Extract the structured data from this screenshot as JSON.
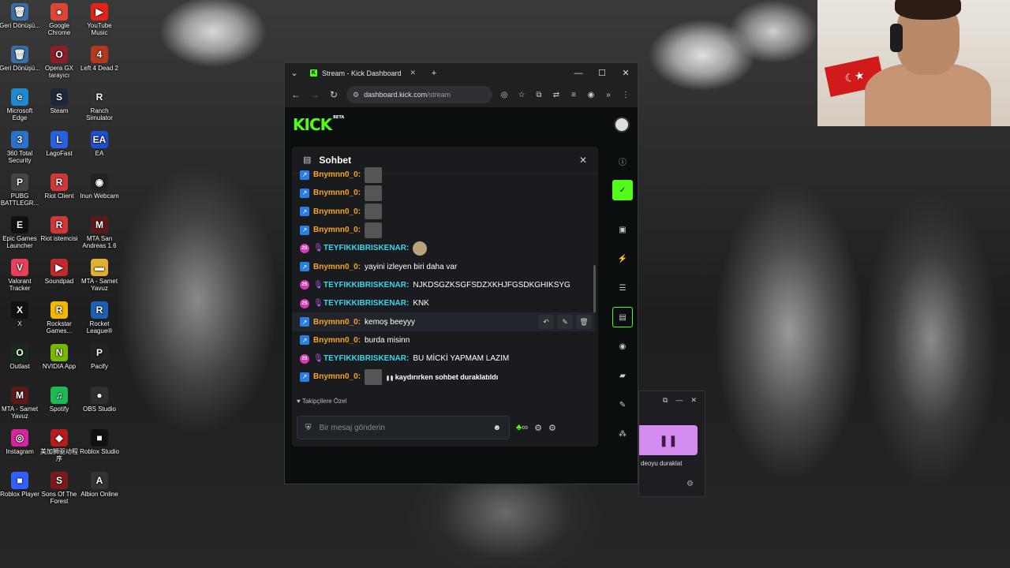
{
  "desktop": {
    "icons": [
      {
        "label": "Geri Dönüşü...",
        "glyph": "🗑",
        "color": "#3b6ea5"
      },
      {
        "label": "Google Chrome",
        "glyph": "●",
        "color": "#db4437"
      },
      {
        "label": "YouTube Music",
        "glyph": "▶",
        "color": "#e62117"
      },
      {
        "label": "Geri Dönüşü...",
        "glyph": "🗑",
        "color": "#3b6ea5"
      },
      {
        "label": "Opera GX tarayıcı",
        "glyph": "O",
        "color": "#8a1f2a"
      },
      {
        "label": "Left 4 Dead 2",
        "glyph": "4",
        "color": "#b03a1a"
      },
      {
        "label": "Microsoft Edge",
        "glyph": "e",
        "color": "#1f8ad0"
      },
      {
        "label": "Steam",
        "glyph": "S",
        "color": "#1b2838"
      },
      {
        "label": "Ranch Simulator",
        "glyph": "R",
        "color": "#333"
      },
      {
        "label": "360 Total Security",
        "glyph": "3",
        "color": "#2a72c9"
      },
      {
        "label": "LagoFast",
        "glyph": "L",
        "color": "#2a5fe0"
      },
      {
        "label": "EA",
        "glyph": "EA",
        "color": "#1f4fd1"
      },
      {
        "label": "PUBG BATTLEGR...",
        "glyph": "P",
        "color": "#444"
      },
      {
        "label": "Riot Client",
        "glyph": "R",
        "color": "#d13639"
      },
      {
        "label": "Inun Webcam",
        "glyph": "◉",
        "color": "#222"
      },
      {
        "label": "Epic Games Launcher",
        "glyph": "E",
        "color": "#111"
      },
      {
        "label": "Riot istemcisi",
        "glyph": "R",
        "color": "#d13639"
      },
      {
        "label": "MTA San Andreas 1.6",
        "glyph": "M",
        "color": "#5a1a1a"
      },
      {
        "label": "Valorant Tracker",
        "glyph": "V",
        "color": "#e83f5b"
      },
      {
        "label": "Soundpad",
        "glyph": "▶",
        "color": "#c02a2a"
      },
      {
        "label": "MTA - Samet Yavuz",
        "glyph": "▬",
        "color": "#e0b030"
      },
      {
        "label": "X",
        "glyph": "X",
        "color": "#111"
      },
      {
        "label": "Rockstar Games...",
        "glyph": "R",
        "color": "#f2b705"
      },
      {
        "label": "Rocket League®",
        "glyph": "R",
        "color": "#1d5fb3"
      },
      {
        "label": "Outlast",
        "glyph": "O",
        "color": "#1a2a1a"
      },
      {
        "label": "NVIDIA App",
        "glyph": "N",
        "color": "#76b900"
      },
      {
        "label": "Pacify",
        "glyph": "P",
        "color": "#222"
      },
      {
        "label": "MTA - Samet Yavuz",
        "glyph": "M",
        "color": "#5a1a1a"
      },
      {
        "label": "Spotify",
        "glyph": "♫",
        "color": "#1db954"
      },
      {
        "label": "OBS Studio",
        "glyph": "●",
        "color": "#302e31"
      },
      {
        "label": "Instagram",
        "glyph": "◎",
        "color": "#d6249f"
      },
      {
        "label": "美加狮驱动程序",
        "glyph": "◆",
        "color": "#b31d1d"
      },
      {
        "label": "Roblox Studio",
        "glyph": "■",
        "color": "#111"
      },
      {
        "label": "Roblox Player",
        "glyph": "■",
        "color": "#335fff"
      },
      {
        "label": "Sons Of The Forest",
        "glyph": "S",
        "color": "#7a1a1a"
      },
      {
        "label": "Albion Online",
        "glyph": "A",
        "color": "#333"
      }
    ]
  },
  "browser": {
    "tab_title": "Stream - Kick Dashboard",
    "url_host": "dashboard.kick.com",
    "url_path": "/stream",
    "new_tab": "+",
    "win_min": "—",
    "win_max": "☐",
    "win_close": "✕"
  },
  "kick": {
    "logo": "KICK",
    "beta": "BETA"
  },
  "chat": {
    "title": "Sohbet",
    "close": "✕",
    "messages": [
      {
        "user": "Bnymnn0_0",
        "text": "",
        "badge": "vip",
        "color": "orange",
        "emote": "img"
      },
      {
        "user": "Bnymnn0_0",
        "text": "",
        "badge": "vip",
        "color": "orange",
        "emote": "img"
      },
      {
        "user": "Bnymnn0_0",
        "text": "",
        "badge": "vip",
        "color": "orange",
        "emote": "img"
      },
      {
        "user": "Bnymnn0_0",
        "text": "",
        "badge": "vip",
        "color": "orange",
        "emote": "img"
      },
      {
        "user": "TEYFIKKIBRISKENAR",
        "text": "",
        "badge": "sub",
        "color": "cyan",
        "emote": "dog"
      },
      {
        "user": "Bnymnn0_0",
        "text": "yayini izleyen biri daha var",
        "badge": "vip",
        "color": "orange",
        "emote": ""
      },
      {
        "user": "TEYFIKKIBRISKENAR",
        "text": "NJKDSGZKSGFSDZXKHJFGSDKGHIKSYG",
        "badge": "sub",
        "color": "cyan",
        "emote": ""
      },
      {
        "user": "TEYFIKKIBRISKENAR",
        "text": "KNK",
        "badge": "sub",
        "color": "cyan",
        "emote": ""
      },
      {
        "user": "Bnymnn0_0",
        "text": "kemoş beeyyy",
        "badge": "vip",
        "color": "orange",
        "emote": ""
      },
      {
        "user": "Bnymnn0_0",
        "text": "burda misinn",
        "badge": "vip",
        "color": "orange",
        "emote": ""
      },
      {
        "user": "TEYFIKKIBRISKENAR",
        "text": "BU MİCKİ YAPMAM LAZIM",
        "badge": "sub",
        "color": "cyan",
        "emote": ""
      },
      {
        "user": "Bnymnn0_0",
        "text": "",
        "badge": "vip",
        "color": "orange",
        "emote": "img"
      }
    ],
    "sub_badge_text": "2S",
    "paused_notice": "kaydırırken sohbet duraklatıldı",
    "followers_only": "Takipçilere Özel",
    "input_placeholder": "Bir mesaj gönderin",
    "infinity_label": "∞"
  },
  "mini_player": {
    "label": "deoyu duraklat",
    "close": "✕",
    "minimize": "—"
  },
  "colors": {
    "kick_green": "#53fc18",
    "user_orange": "#f5a623",
    "user_cyan": "#3ad6ea"
  }
}
